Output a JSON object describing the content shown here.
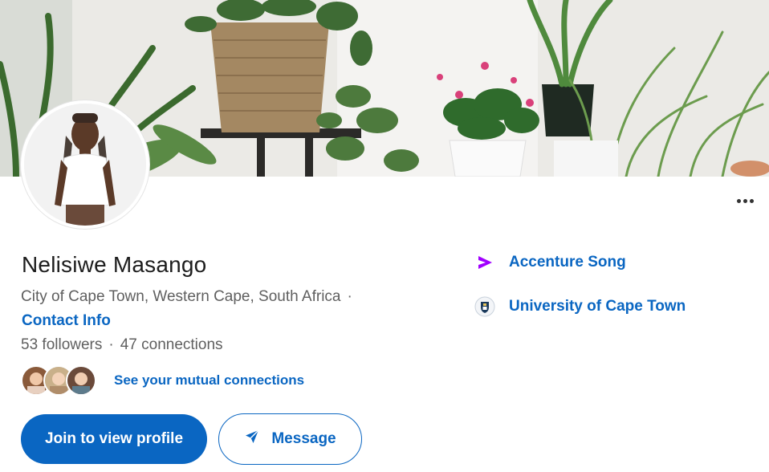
{
  "profile": {
    "name": "Nelisiwe Masango",
    "location": "City of Cape Town, Western Cape, South Africa",
    "location_separator": "·",
    "contact_info_label": "Contact Info",
    "followers": "53 followers",
    "stats_separator": "·",
    "connections": "47 connections",
    "mutual_connections_label": "See your mutual connections"
  },
  "actions": {
    "join_label": "Join to view profile",
    "message_label": "Message",
    "more_icon": "more-horizontal-icon"
  },
  "experience": {
    "company": "Accenture Song",
    "company_logo": "accenture-logo",
    "school": "University of Cape Town",
    "school_logo": "uct-crest"
  },
  "colors": {
    "link_blue": "#0a66c2",
    "accent_purple": "#a100ff",
    "text_dark": "#1d1d1d",
    "text_muted": "#5f5f5f"
  }
}
